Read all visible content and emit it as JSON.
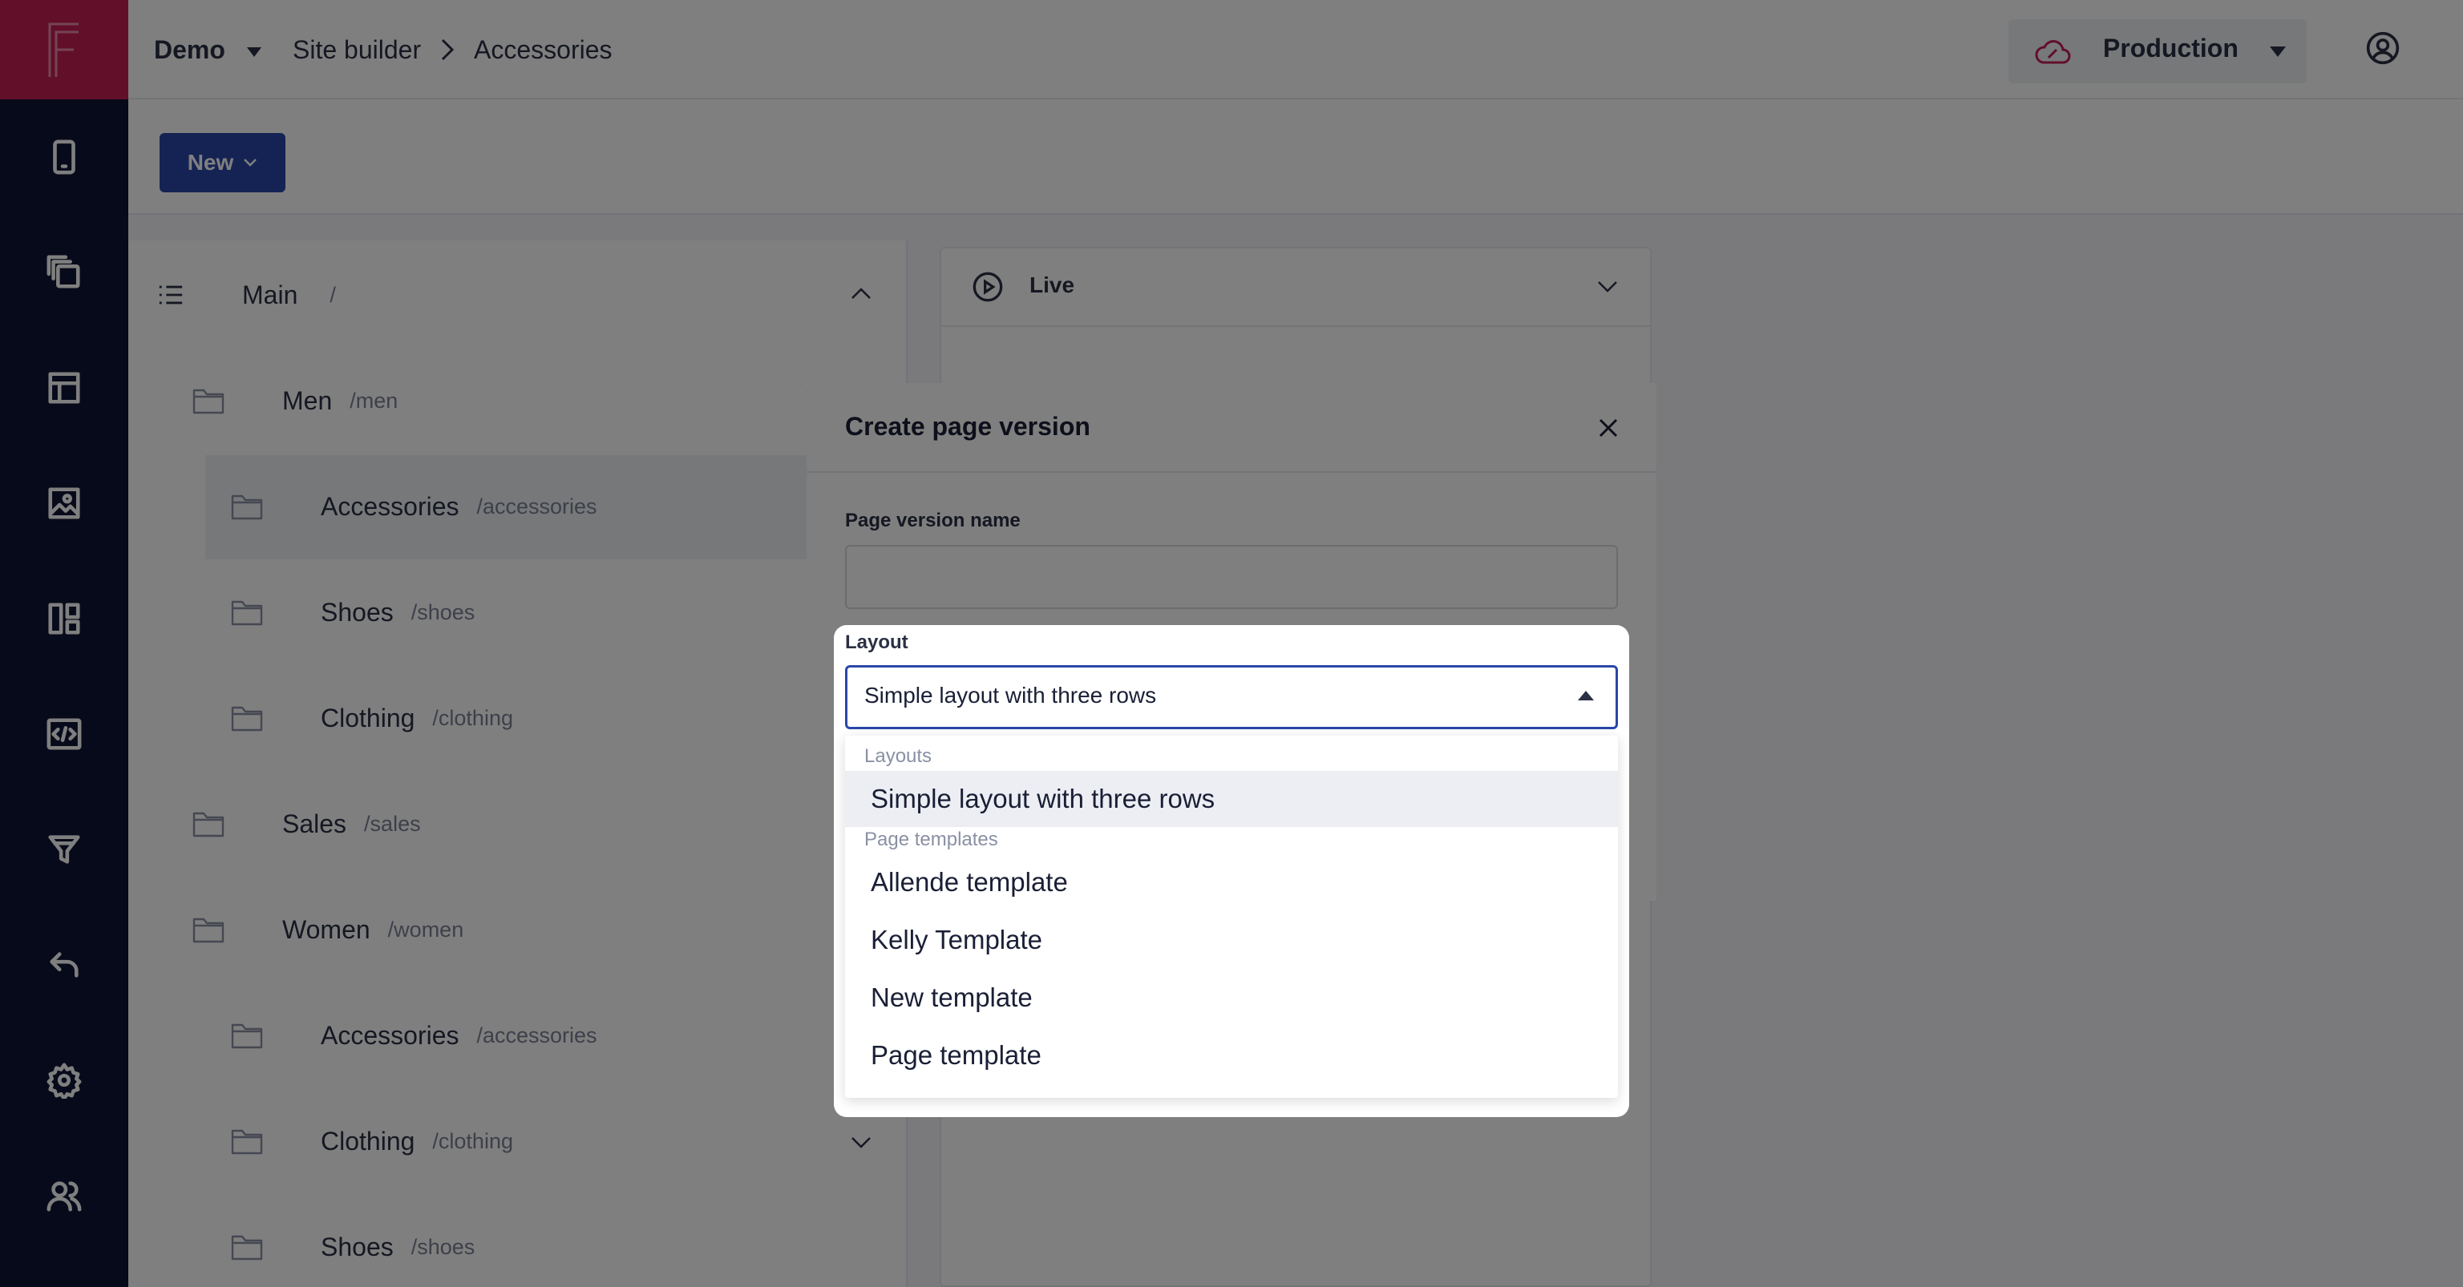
{
  "topbar": {
    "project": "Demo",
    "crumb_section": "Site builder",
    "crumb_current": "Accessories",
    "environment": "Production"
  },
  "actions": {
    "new_label": "New"
  },
  "tree": {
    "root": {
      "name": "Main",
      "path": "/"
    },
    "items": [
      {
        "name": "Men",
        "path": "/men"
      },
      {
        "name": "Accessories",
        "path": "/accessories"
      },
      {
        "name": "Shoes",
        "path": "/shoes"
      },
      {
        "name": "Clothing",
        "path": "/clothing"
      },
      {
        "name": "Sales",
        "path": "/sales"
      },
      {
        "name": "Women",
        "path": "/women"
      },
      {
        "name": "Accessories",
        "path": "/accessories"
      },
      {
        "name": "Clothing",
        "path": "/clothing"
      },
      {
        "name": "Shoes",
        "path": "/shoes"
      }
    ]
  },
  "live_panel": {
    "title": "Live"
  },
  "modal": {
    "title": "Create page version",
    "page_version_label": "Page version name",
    "page_version_value": "",
    "layout_label": "Layout",
    "layout_selected": "Simple layout with three rows",
    "dropdown": {
      "group_layouts": "Layouts",
      "layouts": [
        "Simple layout with three rows"
      ],
      "group_templates": "Page templates",
      "templates": [
        "Allende template",
        "Kelly Template",
        "New template",
        "Page template"
      ]
    }
  },
  "colors": {
    "sidebar": "#0f1535",
    "logo": "#c41f55",
    "primary": "#2a47a8",
    "overlay": "rgba(0,0,0,0.5)"
  },
  "icons": [
    "logo-icon",
    "mobile-icon",
    "copy-icon",
    "layout-icon",
    "image-icon",
    "dashboard-icon",
    "code-icon",
    "filter-icon",
    "undo-icon",
    "gear-icon",
    "users-icon",
    "cloud-icon",
    "user-circle-icon",
    "folder-icon",
    "list-icon",
    "play-circle-icon",
    "close-icon"
  ]
}
